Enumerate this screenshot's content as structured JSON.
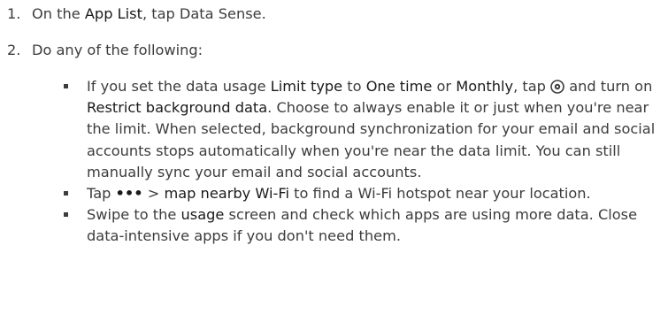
{
  "steps": [
    {
      "number": "1.",
      "before": "On the ",
      "term": "App List",
      "after": ", tap Data Sense."
    },
    {
      "number": "2.",
      "text": "Do any of the following:"
    }
  ],
  "bullets": [
    {
      "p1": "If you set the data usage ",
      "t1": "Limit type",
      "p2": " to ",
      "t2": "One time",
      "p3": " or ",
      "t3": "Monthly",
      "p4": ", tap ",
      "icon": "settings-gear-icon",
      "p5": " and turn on ",
      "t4": "Restrict background data",
      "p6": ". Choose to always enable it or just when you're near the limit. When selected, background synchronization for your email and social accounts stops automatically when you're near the data limit. You can still manually sync your email and social accounts."
    },
    {
      "p1": "Tap ",
      "more": "•••",
      "p2": " > ",
      "t1": "map nearby Wi-Fi",
      "p3": " to find a Wi-Fi hotspot near your location."
    },
    {
      "p1": "Swipe to the ",
      "t1": "usage",
      "p2": " screen and check which apps are using more data. Close data-intensive apps if you don't need them."
    }
  ]
}
